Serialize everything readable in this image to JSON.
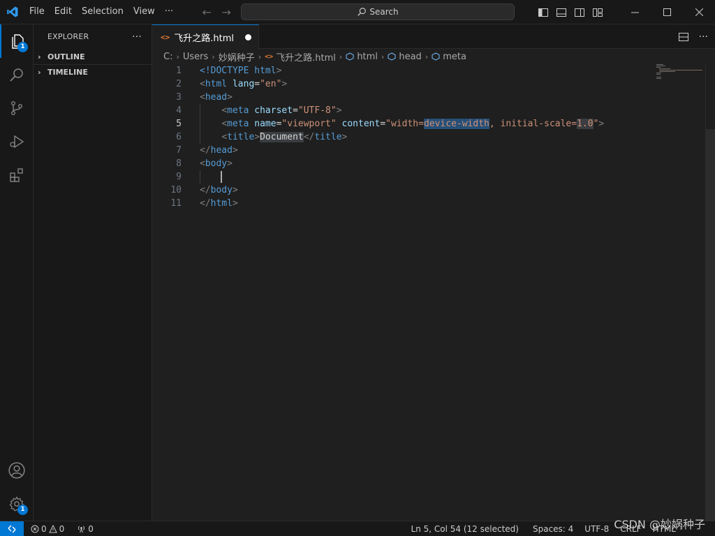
{
  "titlebar": {
    "menu": [
      "File",
      "Edit",
      "Selection",
      "View",
      "···"
    ],
    "search_label": "Search"
  },
  "activity": {
    "explorer_badge": "1",
    "settings_badge": "1"
  },
  "sidebar": {
    "title": "EXPLORER",
    "more": "···",
    "sections": [
      "OUTLINE",
      "TIMELINE"
    ]
  },
  "editor": {
    "tab": {
      "label": "飞升之路.html"
    },
    "breadcrumb": [
      "C:",
      "Users",
      "妙娲种子",
      "飞升之路.html",
      "html",
      "head",
      "meta"
    ],
    "line_numbers": [
      "1",
      "2",
      "3",
      "4",
      "5",
      "6",
      "7",
      "8",
      "9",
      "10",
      "11"
    ],
    "active_line": "5",
    "code": [
      [
        [
          "dt",
          "<!"
        ],
        [
          "dt",
          "DOCTYPE "
        ],
        [
          "tag",
          "html"
        ],
        [
          "br",
          ">"
        ]
      ],
      [
        [
          "br",
          "<"
        ],
        [
          "tag",
          "html "
        ],
        [
          "attr",
          "lang"
        ],
        [
          "text",
          "="
        ],
        [
          "str",
          "\"en\""
        ],
        [
          "br",
          ">"
        ]
      ],
      [
        [
          "br",
          "<"
        ],
        [
          "tag",
          "head"
        ],
        [
          "br",
          ">"
        ]
      ],
      [
        [
          "text",
          "    "
        ],
        [
          "br",
          "<"
        ],
        [
          "tag",
          "meta "
        ],
        [
          "attr",
          "charset"
        ],
        [
          "text",
          "="
        ],
        [
          "str",
          "\"UTF-8\""
        ],
        [
          "br",
          ">"
        ]
      ],
      [
        [
          "text",
          "    "
        ],
        [
          "br",
          "<"
        ],
        [
          "tag",
          "meta "
        ],
        [
          "attr",
          "name"
        ],
        [
          "text",
          "="
        ],
        [
          "str",
          "\"viewport\" "
        ],
        [
          "attr",
          "content"
        ],
        [
          "text",
          "="
        ],
        [
          "str",
          "\"width="
        ],
        [
          "sel",
          "device-width"
        ],
        [
          "str",
          ", initial-scale="
        ],
        [
          "hl",
          "1.0"
        ],
        [
          "str",
          "\""
        ],
        [
          "br",
          ">"
        ]
      ],
      [
        [
          "text",
          "    "
        ],
        [
          "br",
          "<"
        ],
        [
          "tag",
          "title"
        ],
        [
          "br",
          ">"
        ],
        [
          "hltext",
          "Document"
        ],
        [
          "br",
          "</"
        ],
        [
          "tag",
          "title"
        ],
        [
          "br",
          ">"
        ]
      ],
      [
        [
          "br",
          "</"
        ],
        [
          "tag",
          "head"
        ],
        [
          "br",
          ">"
        ]
      ],
      [
        [
          "br",
          "<"
        ],
        [
          "tag",
          "body"
        ],
        [
          "br",
          ">"
        ]
      ],
      [
        [
          "text",
          "    "
        ]
      ],
      [
        [
          "br",
          "</"
        ],
        [
          "tag",
          "body"
        ],
        [
          "br",
          ">"
        ]
      ],
      [
        [
          "br",
          "</"
        ],
        [
          "tag",
          "html"
        ],
        [
          "br",
          ">"
        ]
      ]
    ]
  },
  "statusbar": {
    "errors": "0",
    "warnings": "0",
    "ports": "0",
    "position": "Ln 5, Col 54 (12 selected)",
    "spaces": "Spaces: 4",
    "encoding": "UTF-8",
    "eol": "CRLF",
    "language": "HTML"
  },
  "watermark": "CSDN @妙娲种子",
  "colors": {
    "accent": "#0078d4",
    "background": "#1f1f1f",
    "chrome": "#181818"
  }
}
